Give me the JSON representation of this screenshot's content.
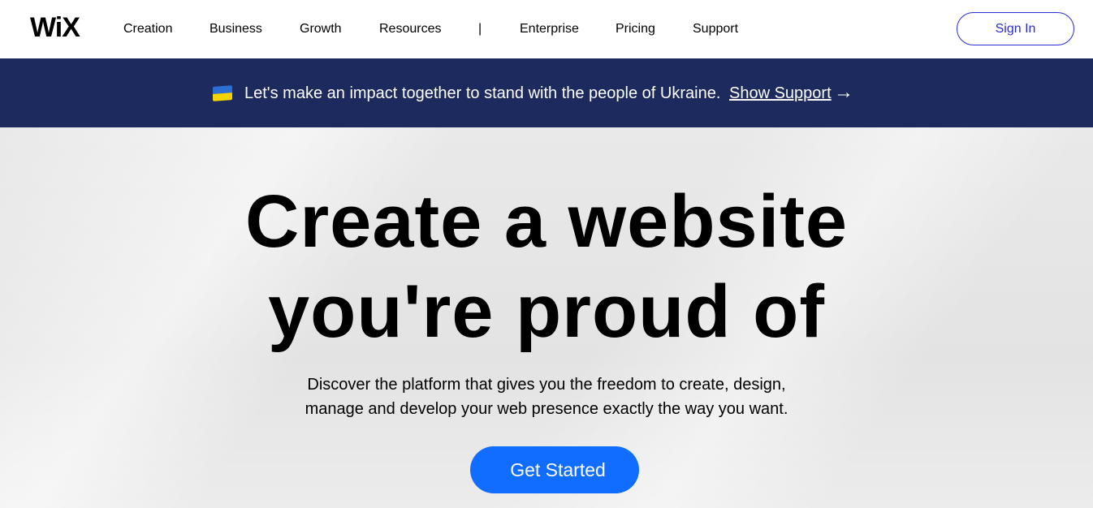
{
  "header": {
    "logo": "WiX",
    "nav": [
      "Creation",
      "Business",
      "Growth",
      "Resources",
      "|",
      "Enterprise",
      "Pricing",
      "Support"
    ],
    "sign_in": "Sign In"
  },
  "banner": {
    "flag_icon": "ukraine-flag-icon",
    "text": "Let's make an impact together to stand with the people of Ukraine.",
    "link": "Show Support",
    "arrow": "→"
  },
  "hero": {
    "title_line1": "Create a website",
    "title_line2": "you're proud of",
    "subtitle_line1": "Discover the platform that gives you the freedom to create, design,",
    "subtitle_line2": "manage and develop your web presence exactly the way you want.",
    "cta": "Get Started"
  },
  "colors": {
    "banner_bg": "#1c2a5e",
    "cta_bg": "#116dff",
    "sign_in_accent": "#2b2bd6"
  }
}
